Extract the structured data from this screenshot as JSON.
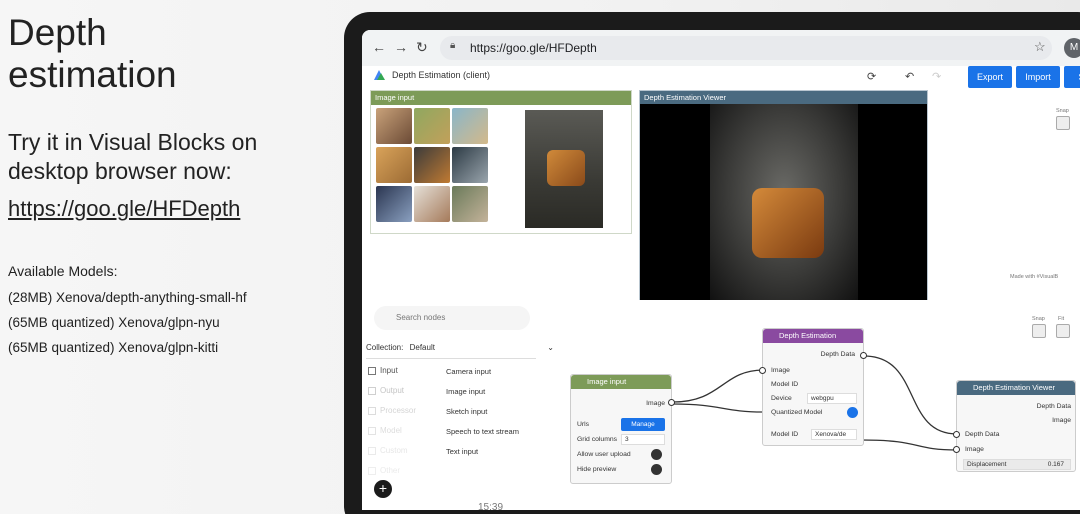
{
  "slide": {
    "title_line1": "Depth",
    "title_line2": "estimation",
    "subtitle_line1": "Try it in Visual Blocks on",
    "subtitle_line2": "desktop browser now:",
    "link": "https://goo.gle/HFDepth",
    "models_title": "Available Models:",
    "models": [
      "(28MB) Xenova/depth-anything-small-hf",
      "(65MB quantized) Xenova/glpn-nyu",
      "(65MB quantized) Xenova/glpn-kitti"
    ],
    "timestamp": "15:39"
  },
  "browser": {
    "url": "https://goo.gle/HFDepth",
    "avatar": "M"
  },
  "app": {
    "title": "Depth Estimation (client)",
    "buttons": {
      "export": "Export",
      "import": "Import",
      "share": "Sh"
    },
    "image_input_panel": "Image input",
    "viewer_panel": "Depth Estimation Viewer",
    "made_with": "Made with #VisualB",
    "side_label_1": "Snap",
    "side_label_2": "Snap",
    "side_label_3": "Fit"
  },
  "library": {
    "search_placeholder": "Search nodes",
    "collection_label": "Collection:",
    "collection_value": "Default",
    "categories": [
      "Input",
      "Output",
      "Processor",
      "Model",
      "Custom",
      "Other"
    ],
    "items": [
      "Camera input",
      "Image input",
      "Sketch input",
      "Speech to text stream",
      "Text input"
    ]
  },
  "nodes": {
    "image_input": {
      "title": "Image input",
      "output": "Image",
      "urls_label": "Urls",
      "manage": "Manage",
      "grid_columns_label": "Grid columns",
      "grid_columns_value": "3",
      "allow_upload": "Allow user upload",
      "hide_preview": "Hide preview"
    },
    "depth_estimation": {
      "title": "Depth Estimation",
      "output": "Depth Data",
      "image": "Image",
      "model_id_label": "Model ID",
      "device_label": "Device",
      "device_value": "webgpu",
      "quantized": "Quantized Model",
      "model_id_value": "Xenova/de"
    },
    "viewer": {
      "title": "Depth Estimation Viewer",
      "out_depth": "Depth Data",
      "out_image": "Image",
      "in_depth": "Depth Data",
      "in_image": "Image",
      "displacement_label": "Displacement",
      "displacement_value": "0.167"
    }
  },
  "colors": {
    "image_input_head": "#7d9b58",
    "viewer_head": "#4a6a80",
    "depth_node_head": "#8a4aa0",
    "primary_button": "#1a73e8"
  }
}
